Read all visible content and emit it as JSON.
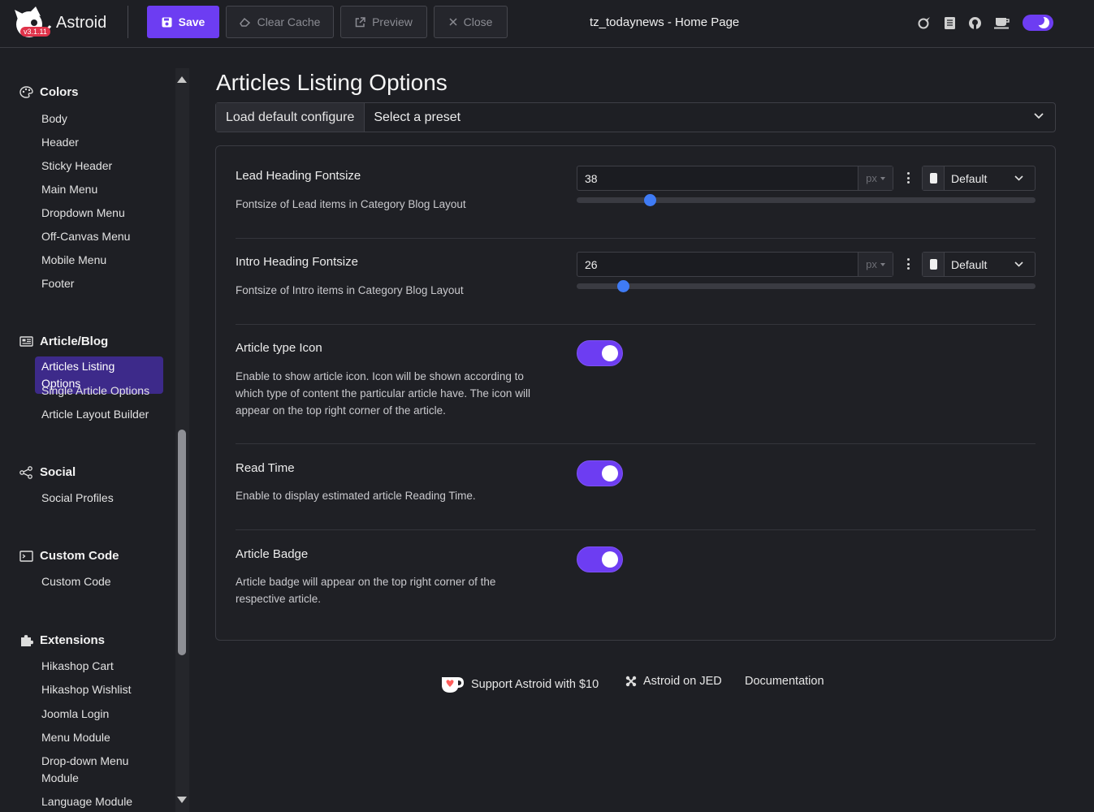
{
  "app": {
    "name": "Astroid",
    "version": "v3.1.11",
    "page_title": "tz_todaynews - Home Page"
  },
  "toolbar": {
    "save_label": "Save",
    "clear_cache_label": "Clear Cache",
    "preview_label": "Preview",
    "close_label": "Close",
    "icons": [
      "rocket-icon",
      "book-icon",
      "github-icon",
      "coffee-icon"
    ],
    "theme_toggle_icon": "moon-icon"
  },
  "sidebar": {
    "groups": [
      {
        "title": "Colors",
        "icon": "palette-icon",
        "items": [
          "Body",
          "Header",
          "Sticky Header",
          "Main Menu",
          "Dropdown Menu",
          "Off-Canvas Menu",
          "Mobile Menu",
          "Footer"
        ]
      },
      {
        "title": "Article/Blog",
        "icon": "newspaper-icon",
        "items": [
          "Articles Listing Options",
          "Single Article Options",
          "Article Layout Builder"
        ],
        "active": "Articles Listing Options"
      },
      {
        "title": "Social",
        "icon": "share-icon",
        "items": [
          "Social Profiles"
        ]
      },
      {
        "title": "Custom Code",
        "icon": "terminal-icon",
        "items": [
          "Custom Code"
        ]
      },
      {
        "title": "Extensions",
        "icon": "puzzle-icon",
        "items": [
          "Hikashop Cart",
          "Hikashop Wishlist",
          "Joomla Login",
          "Menu Module",
          "Drop-down Menu Module",
          "Language Module"
        ]
      }
    ]
  },
  "main": {
    "title": "Articles Listing Options",
    "preset": {
      "load_label": "Load default configure",
      "select_value": "Select a preset"
    },
    "options": [
      {
        "title": "Lead Heading Fontsize",
        "description": "Fontsize of Lead items in Category Blog Layout",
        "value": "38",
        "unit": "px",
        "device": "Default",
        "slider_fraction": 0.16
      },
      {
        "title": "Intro Heading Fontsize",
        "description": "Fontsize of Intro items in Category Blog Layout",
        "value": "26",
        "unit": "px",
        "device": "Default",
        "slider_fraction": 0.1
      },
      {
        "title": "Article type Icon",
        "description_lines": [
          "Enable to show article icon. Icon will be shown according to",
          "which type of content the particular article have. The icon will",
          "appear on the top right corner of the article."
        ],
        "enabled": true
      },
      {
        "title": "Read Time",
        "description": "Enable to display estimated article Reading Time.",
        "enabled": true
      },
      {
        "title": "Article Badge",
        "description_lines": [
          "Article badge will appear on the top right corner of the",
          "respective article."
        ],
        "enabled": true
      }
    ]
  },
  "footer": {
    "support_label": "Support Astroid with $10",
    "jed_label": "Astroid on JED",
    "docs_label": "Documentation"
  },
  "colors": {
    "accent": "#6d3df2",
    "slider_thumb": "#3f7bf5",
    "active_item_bg": "#3d2a8a",
    "badge": "#e0334a"
  }
}
